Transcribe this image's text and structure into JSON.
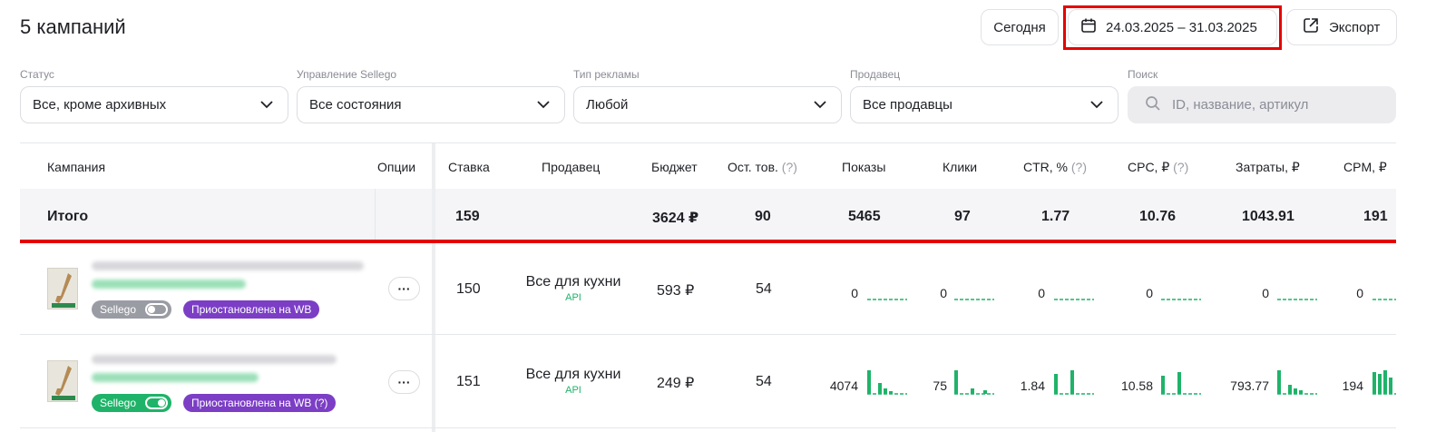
{
  "header": {
    "title": "5 кампаний"
  },
  "toolbar": {
    "today_label": "Сегодня",
    "date_range": "24.03.2025 – 31.03.2025",
    "export_label": "Экспорт"
  },
  "filters": [
    {
      "label": "Статус",
      "value": "Все, кроме архивных"
    },
    {
      "label": "Управление Sellego",
      "value": "Все состояния"
    },
    {
      "label": "Тип рекламы",
      "value": "Любой"
    },
    {
      "label": "Продавец",
      "value": "Все продавцы"
    }
  ],
  "search": {
    "label": "Поиск",
    "placeholder": "ID, название, артикул"
  },
  "columns": {
    "campaign": "Кампания",
    "options": "Опции",
    "bid": "Ставка",
    "seller": "Продавец",
    "budget": "Бюджет",
    "stock": "Ост. тов.",
    "impressions": "Показы",
    "clicks": "Клики",
    "ctr": "CTR, %",
    "cpc": "CPC, ₽",
    "spend": "Затраты, ₽",
    "cpm": "CPM, ₽",
    "hint": "(?)"
  },
  "totals": {
    "label": "Итого",
    "bid": "159",
    "budget": "3624 ₽",
    "stock": "90",
    "impressions": "5465",
    "clicks": "97",
    "ctr": "1.77",
    "cpc": "10.76",
    "spend": "1043.91",
    "cpm": "191"
  },
  "rows": [
    {
      "toggle_label": "Sellego",
      "toggle_on": false,
      "status": "Приостановлена на WB",
      "bid": "150",
      "seller": "Все для кухни",
      "seller_api": "API",
      "budget": "593 ₽",
      "stock": "54",
      "impressions": "0",
      "clicks": "0",
      "ctr": "0",
      "cpc": "0",
      "spend": "0",
      "cpm": "0"
    },
    {
      "toggle_label": "Sellego",
      "toggle_on": true,
      "status": "Приостановлена на WB (?)",
      "bid": "151",
      "seller": "Все для кухни",
      "seller_api": "API",
      "budget": "249 ₽",
      "stock": "54",
      "impressions": "4074",
      "clicks": "75",
      "ctr": "1.84",
      "cpc": "10.58",
      "spend": "793.77",
      "cpm": "194"
    }
  ],
  "colors": {
    "accent_green": "#1fb369",
    "status_purple": "#7b3ec5",
    "highlight_red": "#e60000",
    "toggle_off": "#9a9ca4"
  },
  "icons": [
    "calendar-icon",
    "export-icon",
    "chevron-down-icon",
    "search-icon",
    "more-icon"
  ]
}
